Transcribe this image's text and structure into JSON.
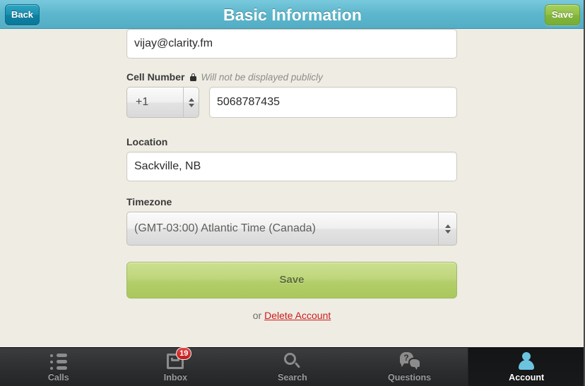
{
  "header": {
    "title": "Basic Information",
    "back_label": "Back",
    "save_label": "Save"
  },
  "form": {
    "email": {
      "value": "vijay@clarity.fm"
    },
    "cell_number": {
      "label": "Cell Number",
      "hint": "Will not be displayed publicly",
      "lock_icon": "lock-icon",
      "country_code": "+1",
      "value": "5068787435"
    },
    "location": {
      "label": "Location",
      "value": "Sackville, NB"
    },
    "timezone": {
      "label": "Timezone",
      "value": "(GMT-03:00) Atlantic Time (Canada)"
    },
    "save_button_label": "Save",
    "delete_prefix": "or ",
    "delete_link_label": "Delete Account"
  },
  "tabbar": {
    "tabs": [
      {
        "label": "Calls",
        "icon": "list-icon",
        "active": false,
        "badge": null
      },
      {
        "label": "Inbox",
        "icon": "inbox-tray-icon",
        "active": false,
        "badge": "19"
      },
      {
        "label": "Search",
        "icon": "magnifier-icon",
        "active": false,
        "badge": null
      },
      {
        "label": "Questions",
        "icon": "speech-bubbles-question-icon",
        "active": false,
        "badge": null
      },
      {
        "label": "Account",
        "icon": "person-icon",
        "active": true,
        "badge": null
      }
    ]
  },
  "colors": {
    "header_bg": "#5cb6cc",
    "back_button": "#0f82a3",
    "save_button_header": "#83b53b",
    "save_button_large": "#b3ce69",
    "delete_link": "#cc1b1b",
    "content_bg": "#efece4",
    "tabbar_bg": "#2c2e30",
    "active_tab_icon": "#6cc3e0",
    "badge_bg": "#c21a1a"
  }
}
